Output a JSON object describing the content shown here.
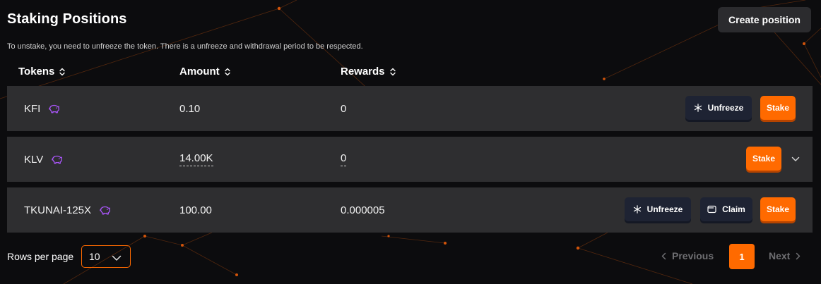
{
  "header": {
    "title": "Staking Positions",
    "subtitle": "To unstake, you need to unfreeze the token. There is a unfreeze and withdrawal period to be respected.",
    "create_label": "Create position"
  },
  "table": {
    "columns": [
      "Tokens",
      "Amount",
      "Rewards"
    ],
    "rows": [
      {
        "token": "KFI",
        "amount": "0.10",
        "rewards": "0",
        "actions": [
          "Unfreeze",
          "Stake"
        ]
      },
      {
        "token": "KLV",
        "amount": "14.00K",
        "rewards": "0",
        "actions": [
          "Stake"
        ]
      },
      {
        "token": "TKUNAI-125X",
        "amount": "100.00",
        "rewards": "0.000005",
        "actions": [
          "Unfreeze",
          "Claim",
          "Stake"
        ]
      }
    ]
  },
  "pagination": {
    "rows_per_page_label": "Rows per page",
    "rows_per_page_value": "10",
    "previous_label": "Previous",
    "current_page": "1",
    "next_label": "Next"
  },
  "icons": {
    "sort": "sort-updown-icon",
    "token": "piggy-bank-icon",
    "unfreeze": "snowflake-icon",
    "claim": "wallet-icon",
    "expand": "chevron-down-icon"
  },
  "colors": {
    "accent": "#ff6a00",
    "background": "#0c0c0e",
    "row": "#2e2e30",
    "dark_button": "#1e2333",
    "token_icon": "#a855f7",
    "muted": "#6f6f72"
  }
}
